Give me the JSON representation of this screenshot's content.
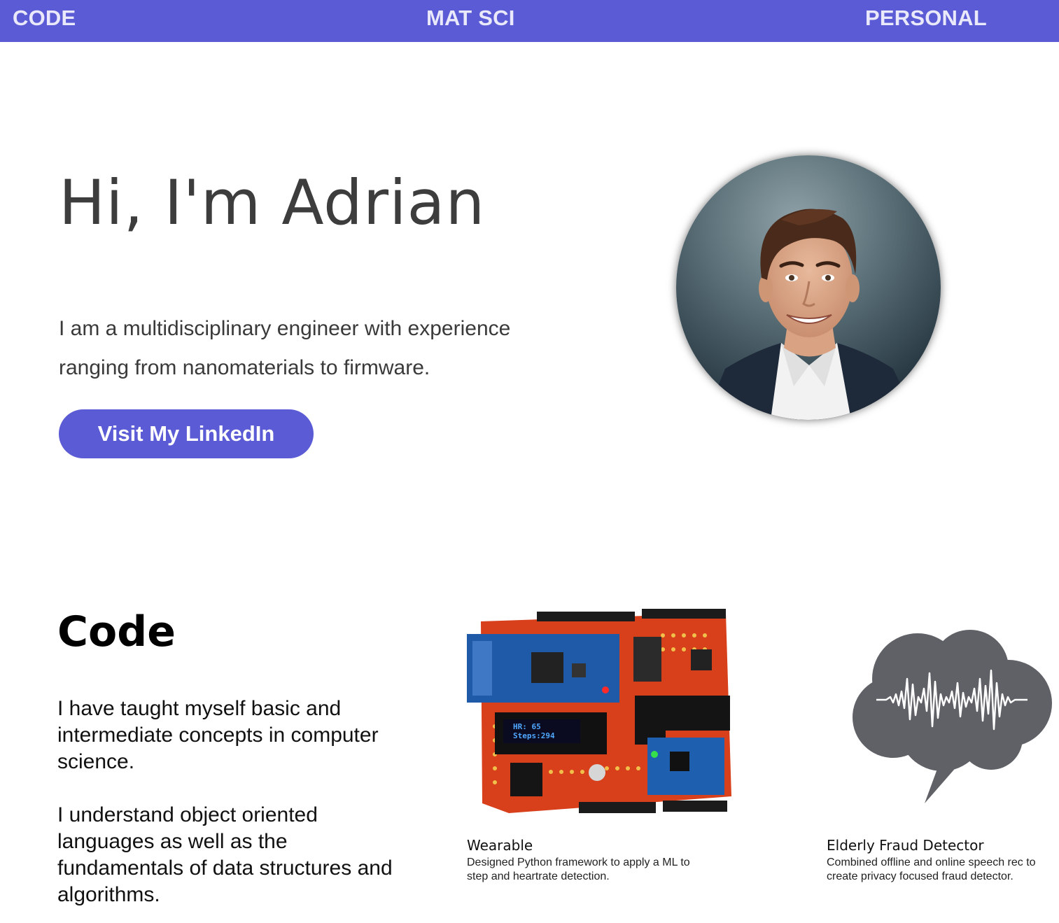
{
  "nav": {
    "items": [
      {
        "label": "CODE"
      },
      {
        "label": "MAT SCI"
      },
      {
        "label": "PERSONAL"
      }
    ]
  },
  "hero": {
    "title": "Hi, I'm Adrian",
    "description": "I am a multidisciplinary engineer with experience ranging from nanomaterials to firmware.",
    "button_label": "Visit My LinkedIn"
  },
  "code_section": {
    "title": "Code",
    "paragraphs": [
      "I have taught myself basic and intermediate concepts in computer science.",
      "I understand object oriented languages as well as the fundamentals of data structures and algorithms."
    ],
    "projects": [
      {
        "title": "Wearable",
        "description": "Designed Python framework to apply a ML to step and heartrate detection.",
        "oled_text": [
          "HR: 65",
          "Steps:294"
        ]
      },
      {
        "title": "Elderly Fraud Detector",
        "description": "Combined offline and online speech rec to create privacy focused fraud detector."
      }
    ]
  },
  "colors": {
    "accent": "#5b5bd6",
    "nav_text": "#e9e9fb",
    "cloud": "#5f6166"
  }
}
